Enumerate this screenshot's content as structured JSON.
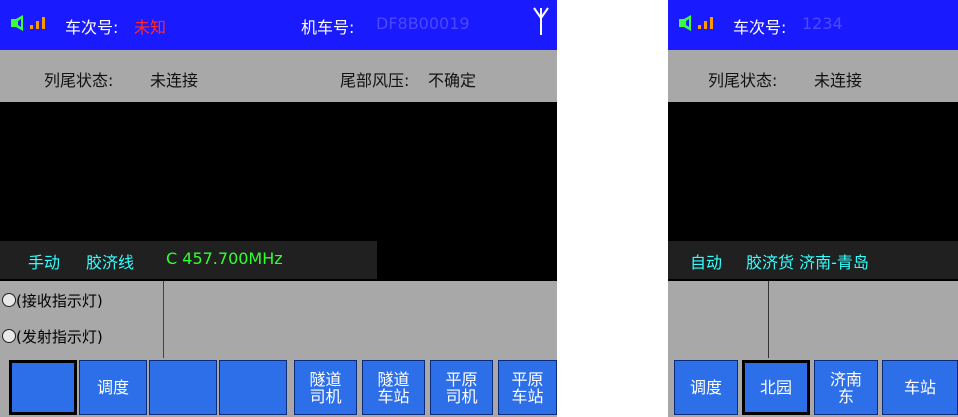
{
  "left_screen": {
    "train_number_label": "车次号:",
    "train_number_value": "未知",
    "locomotive_label": "机车号:",
    "locomotive_value": "DF8B00019",
    "tail_status_label": "列尾状态:",
    "tail_status_value": "未连接",
    "tail_pressure_label": "尾部风压:",
    "tail_pressure_value": "不确定",
    "mode": "手动",
    "line_name": "胶济线",
    "channel": "C 457.700MHz",
    "lamp_receive": "(接收指示灯)",
    "lamp_transmit": "(发射指示灯)",
    "buttons": [
      "",
      "调度",
      "",
      "",
      "隧道\n司机",
      "隧道\n车站",
      "平原\n司机",
      "平原\n车站"
    ]
  },
  "right_screen": {
    "train_number_label": "车次号:",
    "train_number_value": "1234",
    "tail_status_label": "列尾状态:",
    "tail_status_value": "未连接",
    "mode": "自动",
    "line_name": "胶济货 济南-青岛",
    "buttons": [
      "调度",
      "北园",
      "济南\n东",
      "车站"
    ]
  },
  "colors": {
    "topbar": "#1a1aff",
    "status_gray": "#a8a8a8",
    "warning_red": "#ff2a2a",
    "button_blue": "#2d6fe8",
    "freq_green": "#30ff30",
    "text_cyan": "#33ffff"
  }
}
